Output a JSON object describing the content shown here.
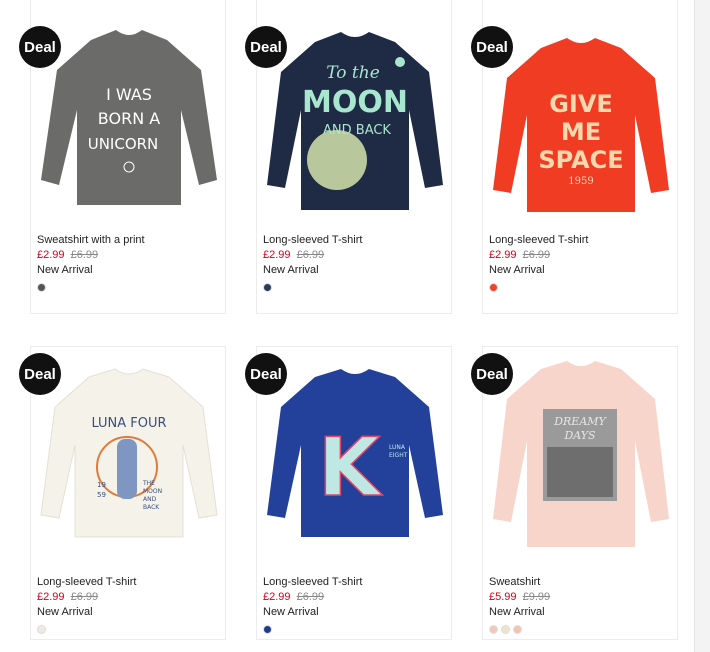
{
  "deal_label": "Deal",
  "products": [
    {
      "name": "Sweatshirt with a print",
      "price": "£2.99",
      "old_price": "£6.99",
      "status": "New Arrival",
      "garment_color": "#6b6b69",
      "print_lines": [
        "I WAS",
        "BORN A",
        "UNICORN"
      ],
      "print_color": "#ffffff",
      "swatches": [
        "#555555"
      ]
    },
    {
      "name": "Long-sleeved T-shirt",
      "price": "£2.99",
      "old_price": "£6.99",
      "status": "New Arrival",
      "garment_color": "#1f2a44",
      "print_lines": [
        "To the",
        "MOON",
        "AND BACK"
      ],
      "print_color": "#a8e6cf",
      "swatches": [
        "#2c3a5a"
      ]
    },
    {
      "name": "Long-sleeved T-shirt",
      "price": "£2.99",
      "old_price": "£6.99",
      "status": "New Arrival",
      "garment_color": "#f03c22",
      "print_lines": [
        "GIVE",
        "ME",
        "SPACE",
        "1959"
      ],
      "print_color": "#f7d9b0",
      "swatches": [
        "#f2412a"
      ]
    },
    {
      "name": "Long-sleeved T-shirt",
      "price": "£2.99",
      "old_price": "£6.99",
      "status": "New Arrival",
      "garment_color": "#f5f2ea",
      "print_lines": [
        "LUNA FOUR",
        "19",
        "59",
        "THE",
        "MOON",
        "AND",
        "BACK"
      ],
      "print_color": "#3a4f7a",
      "swatches": [
        "#efe9e2"
      ]
    },
    {
      "name": "Long-sleeved T-shirt",
      "price": "£2.99",
      "old_price": "£6.99",
      "status": "New Arrival",
      "garment_color": "#23419a",
      "print_lines": [
        "K",
        "LUNA",
        "EIGHT"
      ],
      "print_color": "#bfe8e4",
      "swatches": [
        "#1f3b8c"
      ]
    },
    {
      "name": "Sweatshirt",
      "price": "£5.99",
      "old_price": "£9.99",
      "status": "New Arrival",
      "garment_color": "#f7d5cb",
      "print_lines": [
        "DREAMY",
        "DAYS"
      ],
      "print_color": "#555555",
      "swatches": [
        "#f2c9b8",
        "#efe3cf",
        "#f3c4ad"
      ]
    }
  ]
}
